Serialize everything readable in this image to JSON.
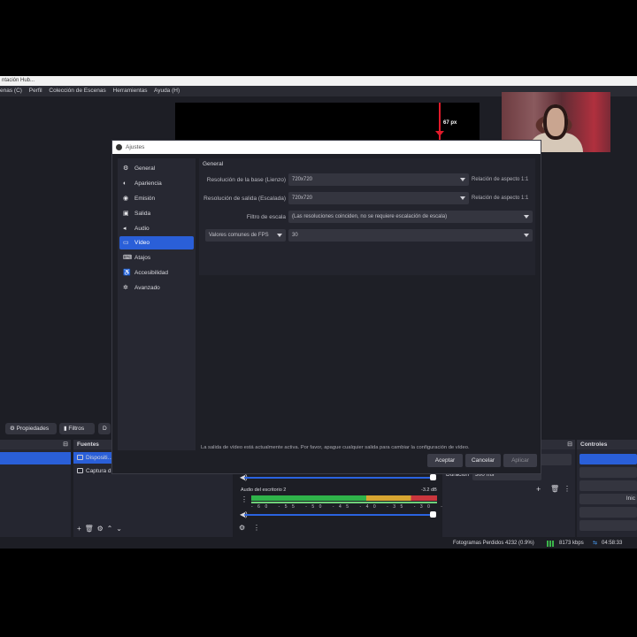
{
  "window": {
    "title": "ntación Hub..."
  },
  "menu": [
    "enas (C)",
    "Perfil",
    "Colección de Escenas",
    "Herramientas",
    "Ayuda (H)"
  ],
  "preview": {
    "measure_label": "67 px"
  },
  "dock_buttons": {
    "properties": "Propiedades",
    "filters": "Filtros",
    "third": "D"
  },
  "scenes": {
    "header": ""
  },
  "sources": {
    "header": "Fuentes",
    "items": [
      "Dispositi...",
      "Captura d..."
    ],
    "toolbar": [
      "+",
      "🗑",
      "⚙",
      "⌃",
      "⌄"
    ]
  },
  "mixer": {
    "track_label": "Audio del escritorio 2",
    "db": "-3.2 dB",
    "scale": "-60 -55 -50 -45 -40 -35 -30 -25 -20 -15 -10 -5 0"
  },
  "transitions": {
    "duration_label": "Duración",
    "duration_value": "300 ms"
  },
  "controls": {
    "header": "Controles",
    "buttons": [
      "",
      "",
      "",
      "Inic",
      "",
      ""
    ]
  },
  "status": {
    "frames_dropped": "Fotogramas Perdidos 4232 (0.9%)",
    "kbps": "8173 kbps",
    "time": "04:58:33"
  },
  "settings_dialog": {
    "title": "Ajustes",
    "nav": [
      {
        "label": "General",
        "icon": "gear-icon",
        "glyph": "⚙"
      },
      {
        "label": "Apariencia",
        "icon": "palette-icon",
        "glyph": "◐"
      },
      {
        "label": "Emisión",
        "icon": "broadcast-icon",
        "glyph": "◉"
      },
      {
        "label": "Salida",
        "icon": "output-icon",
        "glyph": "▣"
      },
      {
        "label": "Audio",
        "icon": "speaker-icon",
        "glyph": "◂"
      },
      {
        "label": "Vídeo",
        "icon": "monitor-icon",
        "glyph": "▭"
      },
      {
        "label": "Atajos",
        "icon": "keyboard-icon",
        "glyph": "⌨"
      },
      {
        "label": "Accesibilidad",
        "icon": "accessibility-icon",
        "glyph": "♿"
      },
      {
        "label": "Avanzado",
        "icon": "wrench-icon",
        "glyph": "✲"
      }
    ],
    "active_nav": "Vídeo",
    "section_title": "General",
    "fields": {
      "base_resolution_label": "Resolución de la base (Lienzo)",
      "base_resolution_value": "720x720",
      "base_aspect": "Relación de aspecto 1:1",
      "output_resolution_label": "Resolución de salida (Escalada)",
      "output_resolution_value": "720x720",
      "output_aspect": "Relación de aspecto 1:1",
      "scale_filter_label": "Filtro de escala",
      "scale_filter_value": "(Las resoluciones coinciden, no se requiere escalación de escala)",
      "fps_mode_value": "Valores comunes de FPS",
      "fps_value": "30"
    },
    "warning": "La salida de vídeo está actualmente activa. Por favor, apague cualquier salida para cambiar la configuración de vídeo.",
    "buttons": {
      "accept": "Aceptar",
      "cancel": "Cancelar",
      "apply": "Aplicar"
    }
  }
}
